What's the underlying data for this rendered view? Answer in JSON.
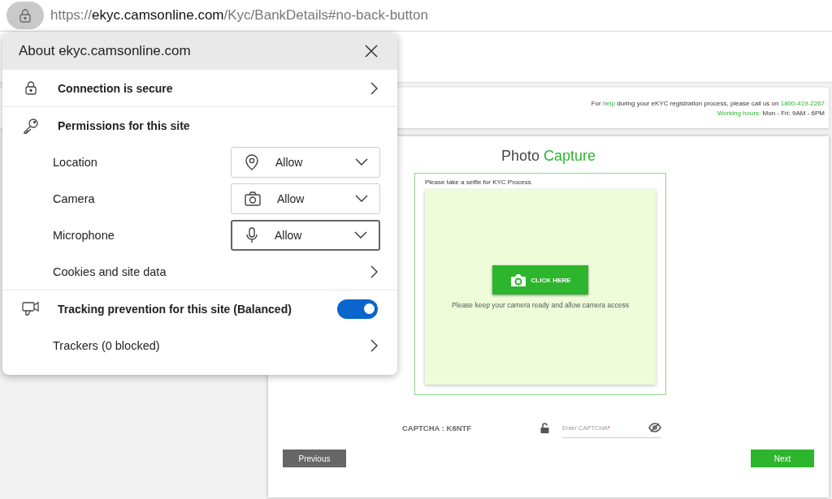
{
  "address_bar": {
    "url_parts": [
      {
        "text": "https://",
        "emphasis": false
      },
      {
        "text": "ekyc.camsonline.com",
        "emphasis": true
      },
      {
        "text": "/Kyc/BankDetails#no-back-button",
        "emphasis": false
      }
    ]
  },
  "site_info_popup": {
    "title": "About ekyc.camsonline.com",
    "connection": {
      "label": "Connection is secure"
    },
    "permissions": {
      "heading": "Permissions for this site",
      "items": [
        {
          "label": "Location",
          "kind": "location",
          "value": "Allow",
          "focused": false
        },
        {
          "label": "Camera",
          "kind": "camera",
          "value": "Allow",
          "focused": false
        },
        {
          "label": "Microphone",
          "kind": "microphone",
          "value": "Allow",
          "focused": true
        }
      ],
      "cookies": "Cookies and site data"
    },
    "tracking": {
      "label": "Tracking prevention for this site (Balanced)",
      "on": true,
      "trackers": "Trackers (0 blocked)"
    }
  },
  "header": {
    "help_parts": [
      {
        "text": "For ",
        "highlight": false
      },
      {
        "text": "help",
        "highlight": true
      },
      {
        "text": " during your eKYC registration process, please call us on ",
        "highlight": false
      },
      {
        "text": "1800-419-2267",
        "highlight": true
      }
    ],
    "hours_parts": [
      {
        "text": "Working hours:",
        "highlight": true
      },
      {
        "text": " Mon - Fri: 9AM - 6PM",
        "highlight": false
      }
    ]
  },
  "card": {
    "title_parts": [
      {
        "text": "Photo ",
        "highlight": false
      },
      {
        "text": "Capture",
        "highlight": true
      }
    ],
    "instruction": "Please take a selfie for KYC Process",
    "capture_button": "CLICK HERE",
    "hint": "Please keep your camera ready and allow camera access",
    "captcha_label": "CAPTCHA : K6NTF",
    "captcha_placeholder": "Enter CAPTCHA",
    "captcha_required_mark": "*",
    "previous": "Previous",
    "next": "Next"
  }
}
